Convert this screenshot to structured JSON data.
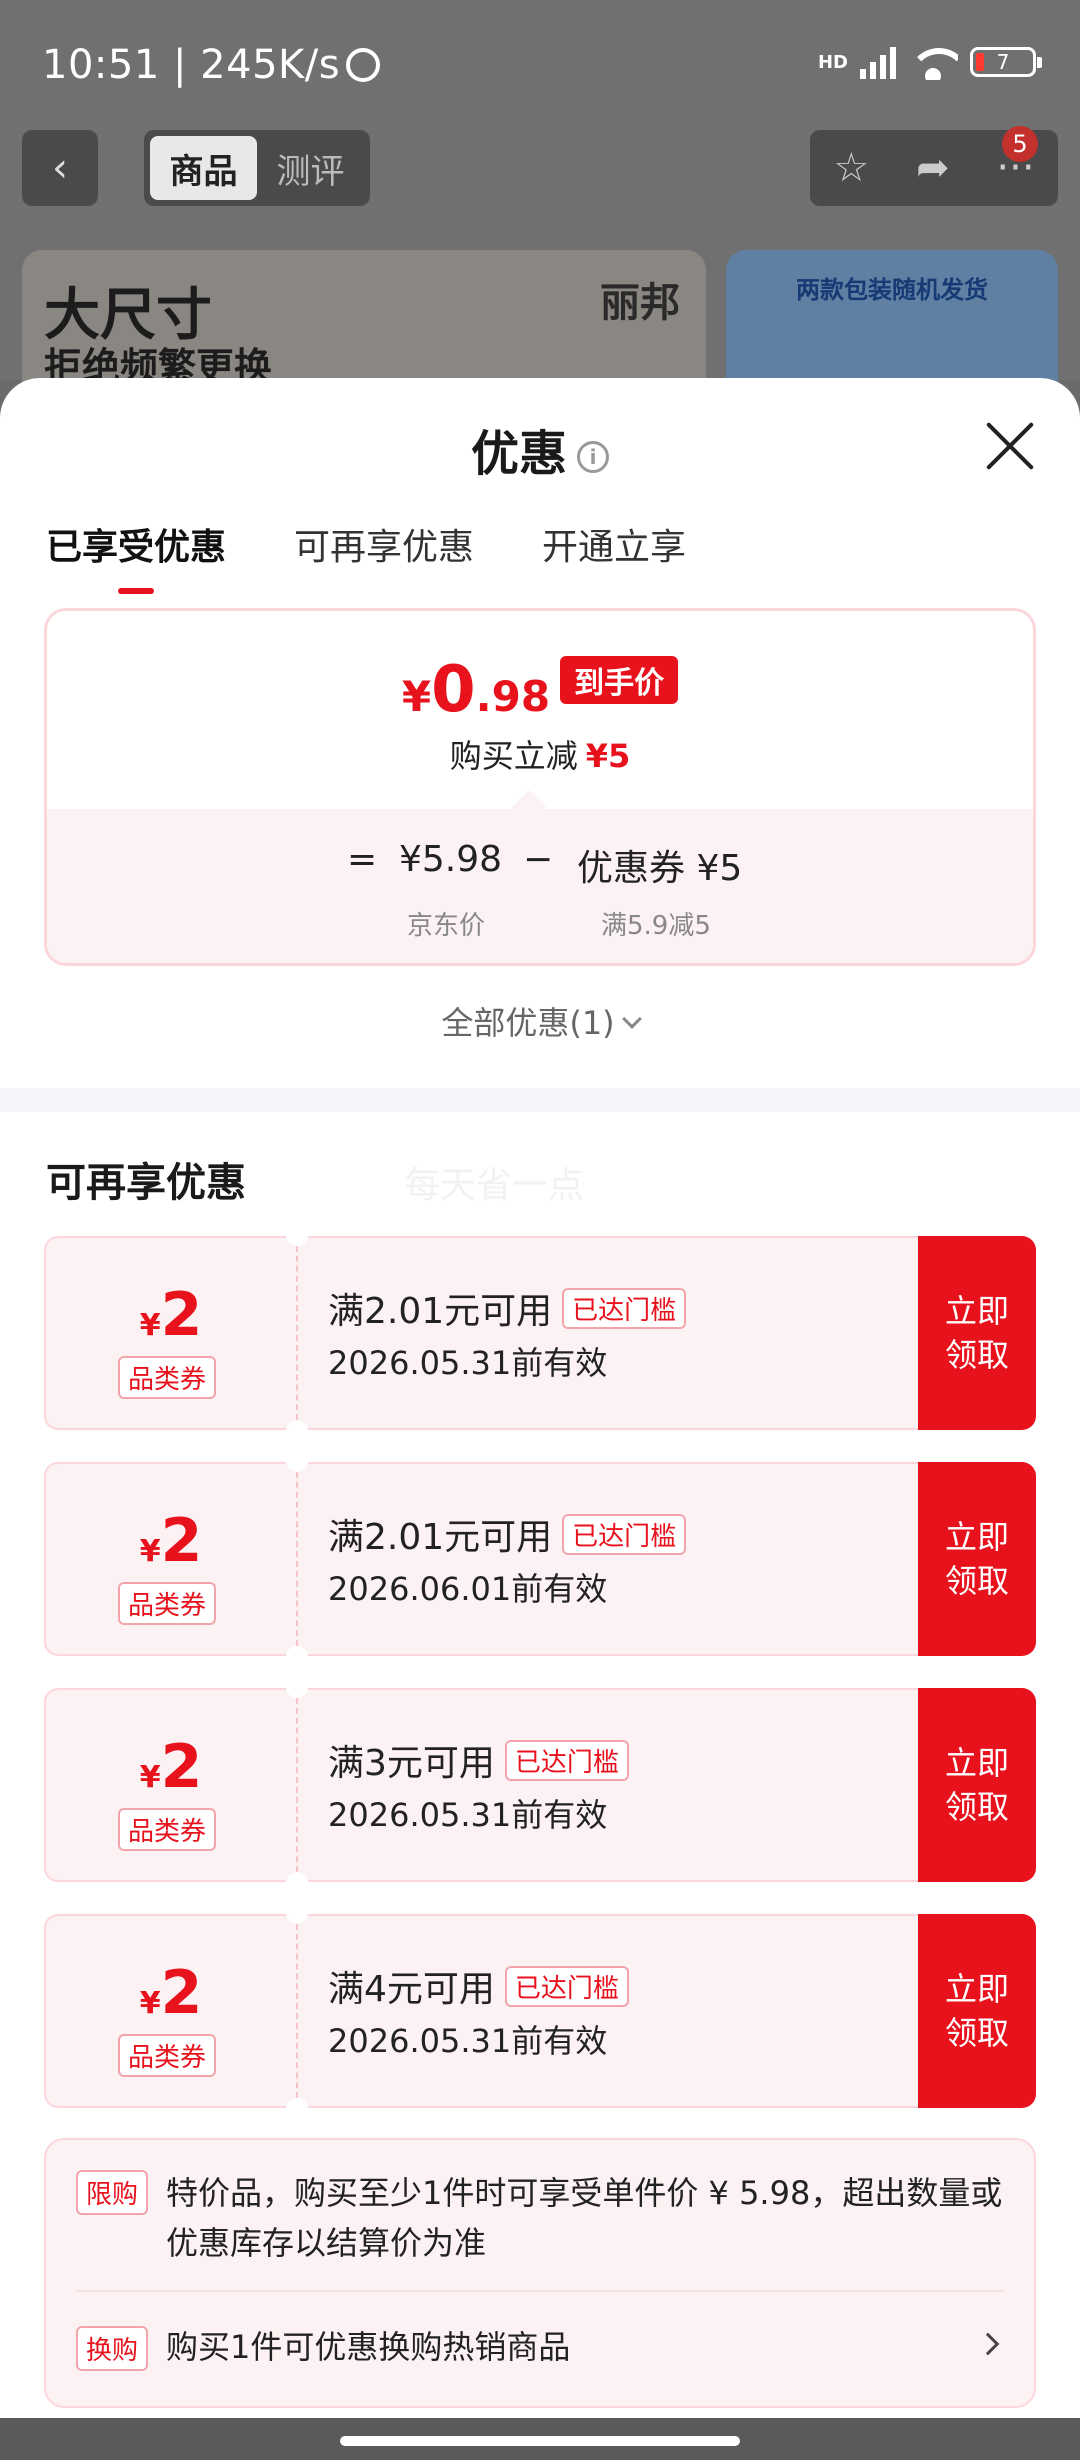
{
  "status_bar": {
    "time": "10:51 | 245K/s",
    "network": "HD",
    "battery": "7"
  },
  "nav": {
    "back_icon": "chevron-left-icon",
    "tabs": [
      "商品",
      "测评"
    ],
    "active_tab": "商品",
    "badge_count": "5"
  },
  "banner": {
    "headline": "大尺寸",
    "subline": "拒绝频繁更换",
    "brand": "丽邦",
    "right_caption": "两款包装随机发货"
  },
  "sheet": {
    "title": "优惠",
    "tabs": [
      "已享受优惠",
      "可再享优惠",
      "开通立享"
    ],
    "summary": {
      "currency": "¥",
      "price_int": "0",
      "price_dec": ".98",
      "price_tag": "到手价",
      "instant_cut_label": "购买立减",
      "instant_cut_value": "¥5",
      "eq": "=",
      "base_price": "¥5.98",
      "minus": "−",
      "coupon_value": "优惠券 ¥5",
      "base_label": "京东价",
      "coupon_label": "满5.9减5"
    },
    "all_offers": "全部优惠(1)",
    "section_title": "可再享优惠",
    "watermark": "每天省一点",
    "coupons": [
      {
        "symbol": "¥",
        "amount": "2",
        "type": "品类券",
        "condition": "满2.01元可用",
        "status": "已达门槛",
        "valid": "2026.05.31前有效",
        "action": "立即\n领取"
      },
      {
        "symbol": "¥",
        "amount": "2",
        "type": "品类券",
        "condition": "满2.01元可用",
        "status": "已达门槛",
        "valid": "2026.06.01前有效",
        "action": "立即\n领取"
      },
      {
        "symbol": "¥",
        "amount": "2",
        "type": "品类券",
        "condition": "满3元可用",
        "status": "已达门槛",
        "valid": "2026.05.31前有效",
        "action": "立即\n领取"
      },
      {
        "symbol": "¥",
        "amount": "2",
        "type": "品类券",
        "condition": "满4元可用",
        "status": "已达门槛",
        "valid": "2026.05.31前有效",
        "action": "立即\n领取"
      }
    ],
    "limit": {
      "tag": "限购",
      "text": "特价品，购买至少1件时可享受单件价 ¥ 5.98，超出数量或优惠库存以结算价为准"
    },
    "swap": {
      "tag": "换购",
      "text": "购买1件可优惠换购热销商品"
    }
  },
  "colors": {
    "accent": "#e8121d",
    "coupon_bg": "#fdf2f3",
    "border": "#fbd6da"
  }
}
